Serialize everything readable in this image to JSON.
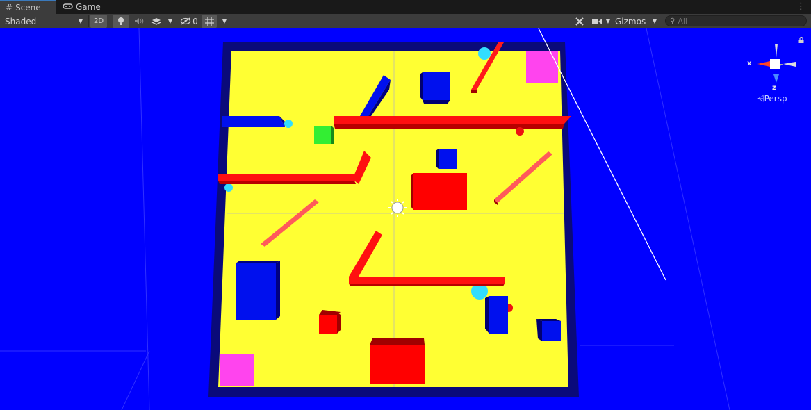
{
  "tabs": [
    {
      "label": "Scene",
      "icon": "grid-icon",
      "active": true
    },
    {
      "label": "Game",
      "icon": "gamepad-icon",
      "active": false
    }
  ],
  "toolbar": {
    "shading_mode": "Shaded",
    "mode_2d": "2D",
    "hidden_count": "0",
    "gizmos_label": "Gizmos",
    "search_placeholder": "All"
  },
  "viewport": {
    "background_color": "#0000ff",
    "floor_color": "#ffff33",
    "wall_color": "#ff0000",
    "block_color": "#0000ee",
    "goal_color": "#ff44ee",
    "agent_color": "#33ee33",
    "sphere_color": "#33ddff"
  },
  "orientation_gizmo": {
    "x_label": "x",
    "z_label": "z",
    "projection_label": "Persp"
  }
}
